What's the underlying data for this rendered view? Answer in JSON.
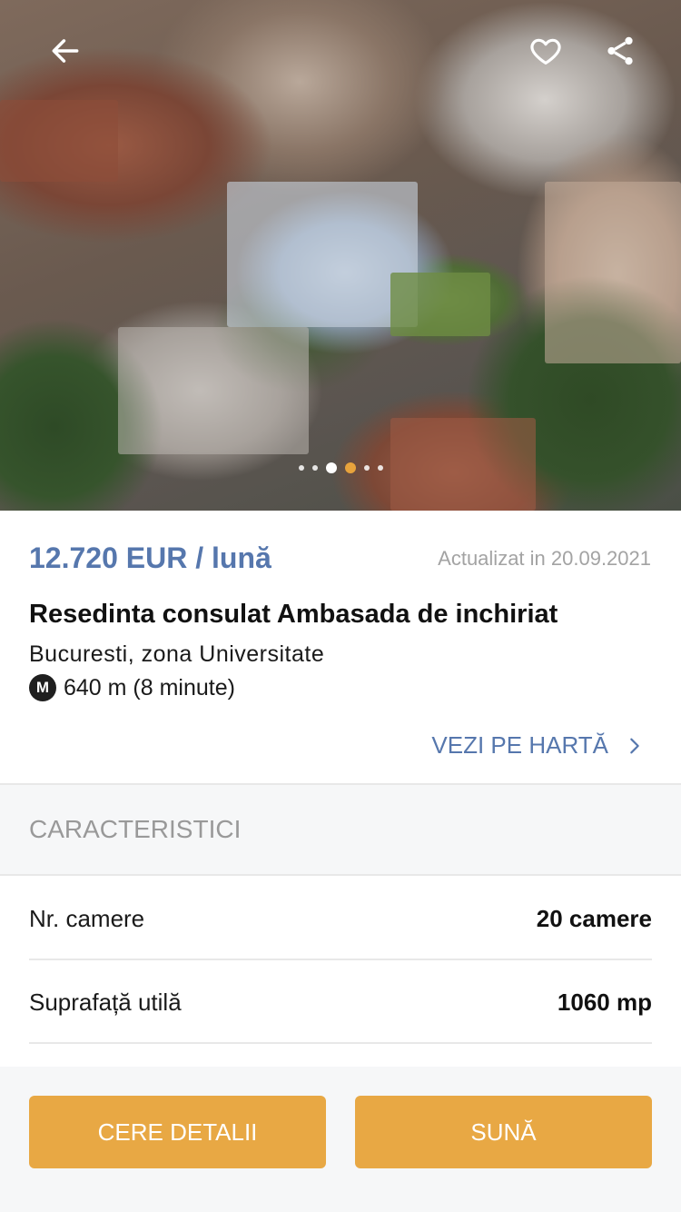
{
  "hero": {
    "icons": {
      "back": "arrow-left-icon",
      "favorite": "heart-outline-icon",
      "share": "share-icon"
    },
    "gallery": {
      "count": 6,
      "active_index": 3
    }
  },
  "listing": {
    "price": "12.720 EUR / lună",
    "updated": "Actualizat in 20.09.2021",
    "title": "Resedinta consulat Ambasada de inchiriat",
    "location": "Bucuresti, zona Universitate",
    "metro_badge": "M",
    "metro_distance": "640 m (8 minute)",
    "map_link": "VEZI PE HARTĂ"
  },
  "characteristics": {
    "heading": "CARACTERISTICI",
    "rows": [
      {
        "label": "Nr. camere",
        "value": "20 camere"
      },
      {
        "label": "Suprafață utilă",
        "value": "1060 mp"
      }
    ]
  },
  "actions": {
    "details": "CERE DETALII",
    "call": "SUNĂ"
  },
  "colors": {
    "accent": "#5677ad",
    "button": "#e8a844",
    "active_dot": "#e8a33c"
  }
}
